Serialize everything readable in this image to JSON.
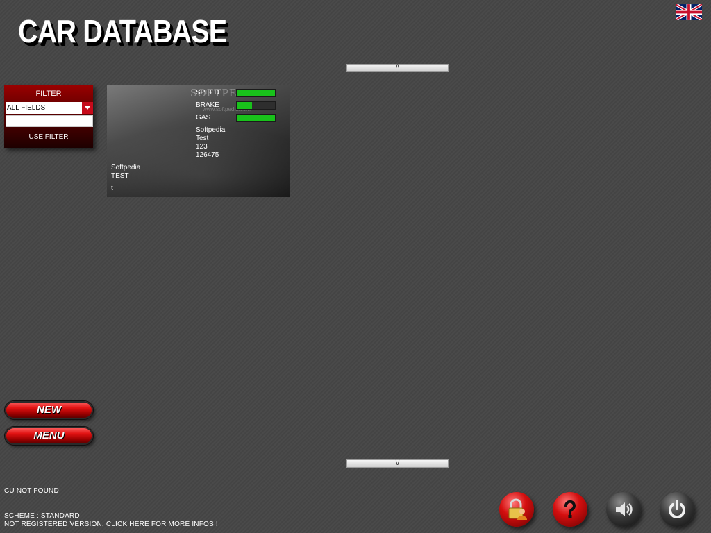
{
  "header": {
    "title": "CAR DATABASE"
  },
  "scroll": {
    "up_label": "/\\",
    "down_label": "\\/"
  },
  "filter": {
    "title": "FILTER",
    "field_selected": "ALL FIELDS",
    "search_value": "",
    "apply_label": "USE FILTER"
  },
  "car": {
    "watermark": "SOFTPEDIA",
    "watermark_sub": "www.softpedia.com",
    "stats": [
      {
        "label": "SPEED",
        "value": 1.0
      },
      {
        "label": "BRAKE",
        "value": 0.4
      },
      {
        "label": "GAS",
        "value": 1.0
      }
    ],
    "details": [
      "Softpedia",
      "Test",
      "123",
      "126475"
    ],
    "name": "Softpedia",
    "model": "TEST",
    "note": "t"
  },
  "actions": {
    "new_label": "NEW",
    "menu_label": "MENU"
  },
  "status": {
    "cu": "CU NOT FOUND",
    "scheme": "SCHEME : STANDARD",
    "registration": "NOT REGISTERED VERSION. CLICK HERE FOR MORE INFOS !"
  },
  "colors": {
    "accent_red": "#c60a1a",
    "stat_green": "#19c21b",
    "background": "#464646"
  },
  "icons": [
    "uk-flag-icon",
    "lock-user-icon",
    "help-icon",
    "speaker-icon",
    "power-icon"
  ]
}
